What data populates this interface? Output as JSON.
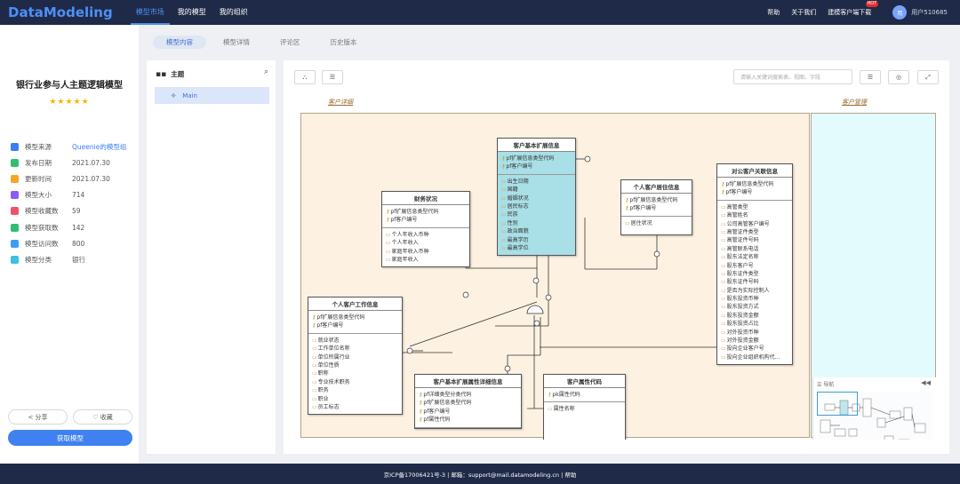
{
  "header": {
    "logo": "DataModeling",
    "nav": [
      {
        "label": "模型市场",
        "active": true
      },
      {
        "label": "我的模型",
        "active": false
      },
      {
        "label": "我的组织",
        "active": false
      }
    ],
    "help": "帮助",
    "about": "关于我们",
    "download": "建模客户端下载",
    "hot_badge": "HOT",
    "avatar_initial": "用",
    "username": "用户510685"
  },
  "model": {
    "title": "银行业参与人主题逻辑模型",
    "stars": "★★★★★",
    "rating": 5,
    "info": [
      {
        "label": "模型来源",
        "value": "Queenie的模型组",
        "icon": "source-icon",
        "color": "#3c7df4",
        "link": true
      },
      {
        "label": "发布日期",
        "value": "2021.07.30",
        "icon": "calendar-icon",
        "color": "#2fbf71"
      },
      {
        "label": "更新时间",
        "value": "2021.07.30",
        "icon": "edit-icon",
        "color": "#f5a623"
      },
      {
        "label": "模型大小",
        "value": "714",
        "icon": "layers-icon",
        "color": "#8a5cf6"
      },
      {
        "label": "模型收藏数",
        "value": "59",
        "icon": "heart-icon",
        "color": "#f0506e"
      },
      {
        "label": "模型获取数",
        "value": "142",
        "icon": "download-icon",
        "color": "#2fbf71"
      },
      {
        "label": "模型访问数",
        "value": "800",
        "icon": "eye-icon",
        "color": "#3c9df4"
      },
      {
        "label": "模型分类",
        "value": "银行",
        "icon": "category-icon",
        "color": "#3cc0e0"
      }
    ],
    "share_label": "分享",
    "favorite_label": "收藏",
    "get_label": "获取模型"
  },
  "tabs": [
    {
      "label": "模型内容",
      "active": true
    },
    {
      "label": "模型详情",
      "active": false
    },
    {
      "label": "评论区",
      "active": false
    },
    {
      "label": "历史版本",
      "active": false
    }
  ],
  "tree": {
    "title": "主题",
    "items": [
      {
        "label": "Main",
        "selected": true
      }
    ]
  },
  "canvas": {
    "search_placeholder": "请输入关键词搜索表、视图、字段",
    "zones": {
      "left": "客户详细",
      "right": "客户管理"
    },
    "minimap_title": "导航",
    "entities": {
      "cust_ext": {
        "title": "客户基本扩展信息",
        "keys": [
          "pf扩展信息类型代码",
          "pf客户编号"
        ],
        "attrs": [
          "出生日期",
          "国籍",
          "婚姻状况",
          "居民标志",
          "民族",
          "性别",
          "政治面貌",
          "最高学历",
          "最高学位"
        ]
      },
      "finance": {
        "title": "财务状况",
        "keys": [
          "pf扩展信息类型代码",
          "pf客户编号"
        ],
        "attrs": [
          "个人年收入币种",
          "个人年收入",
          "家庭年收入币种",
          "家庭年收入"
        ]
      },
      "residence": {
        "title": "个人客户居住信息",
        "keys": [
          "pf扩展信息类型代码",
          "pf客户编号"
        ],
        "attrs": [
          "居住状况"
        ]
      },
      "corp": {
        "title": "对公客户关联信息",
        "keys": [
          "pf扩展信息类型代码",
          "pf客户编号"
        ],
        "attrs": [
          "高管类型",
          "高管姓名",
          "公司高管客户编号",
          "高管证件类型",
          "高管证件号码",
          "高管联系电话",
          "股东法定名称",
          "股东客户号",
          "股东证件类型",
          "股东证件号码",
          "是否为实际控制人",
          "股东投资币种",
          "股东投资方式",
          "股东投资金额",
          "股东投资占比",
          "对外投资币种",
          "对外投资金额",
          "投向企业客户号",
          "投向企业组织机构代..."
        ]
      },
      "work": {
        "title": "个人客户工作信息",
        "keys": [
          "pf扩展信息类型代码",
          "pf客户编号"
        ],
        "attrs": [
          "就业状态",
          "工作单位名称",
          "单位所属行业",
          "单位性质",
          "职称",
          "专业技术职务",
          "职务",
          "职业",
          "员工标志"
        ]
      },
      "attr_detail": {
        "title": "客户基本扩展属性详细信息",
        "keys": [
          "pf详细类型分类代码",
          "pf扩展信息类型代码",
          "pf客户编号",
          "pf属性代码"
        ],
        "attrs": []
      },
      "attr_code": {
        "title": "客户属性代码",
        "keys": [
          "pk属性代码"
        ],
        "attrs": [
          "属性名称"
        ]
      }
    }
  },
  "footer": "京ICP备17006421号-3 | 邮箱：support@mail.datamodeling.cn | 帮助"
}
